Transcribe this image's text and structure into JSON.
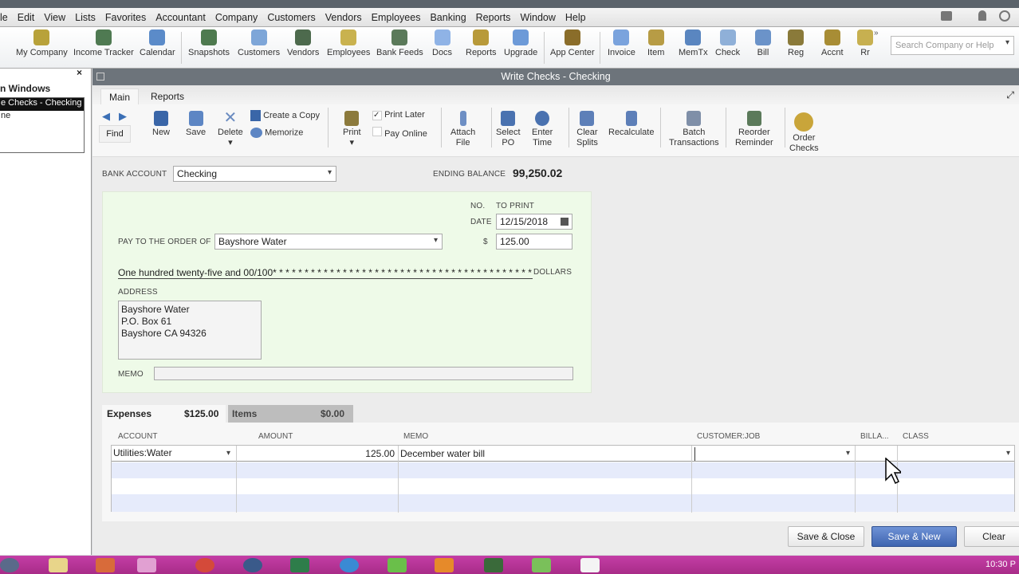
{
  "menu": [
    "le",
    "Edit",
    "View",
    "Lists",
    "Favorites",
    "Accountant",
    "Company",
    "Customers",
    "Vendors",
    "Employees",
    "Banking",
    "Reports",
    "Window",
    "Help"
  ],
  "iconbar": [
    {
      "label": "My Company",
      "icon": "my-company-icon",
      "color": "#b8a23a"
    },
    {
      "label": "Income Tracker",
      "icon": "income-tracker-icon",
      "color": "#4f7a52"
    },
    {
      "label": "Calendar",
      "icon": "calendar-icon",
      "color": "#5b8bc9"
    },
    {
      "label": "Snapshots",
      "icon": "snapshots-icon",
      "color": "#4e7a4f"
    },
    {
      "label": "Customers",
      "icon": "customers-icon",
      "color": "#7ea6d8"
    },
    {
      "label": "Vendors",
      "icon": "vendors-icon",
      "color": "#4d6a4d"
    },
    {
      "label": "Employees",
      "icon": "employees-icon",
      "color": "#c9b24f"
    },
    {
      "label": "Bank Feeds",
      "icon": "bank-feeds-icon",
      "color": "#5b7a5a"
    },
    {
      "label": "Docs",
      "icon": "docs-icon",
      "color": "#8fb3e6"
    },
    {
      "label": "Reports",
      "icon": "reports-icon",
      "color": "#b89a3a"
    },
    {
      "label": "Upgrade",
      "icon": "upgrade-icon",
      "color": "#6c9ad8"
    },
    {
      "label": "App Center",
      "icon": "app-center-icon",
      "color": "#8a6d2a"
    },
    {
      "label": "Invoice",
      "icon": "invoice-icon",
      "color": "#7aa3dd"
    },
    {
      "label": "Item",
      "icon": "item-icon",
      "color": "#b79c45"
    },
    {
      "label": "MemTx",
      "icon": "memtx-icon",
      "color": "#5a86c0"
    },
    {
      "label": "Check",
      "icon": "check-icon",
      "color": "#8fb0d8"
    },
    {
      "label": "Bill",
      "icon": "bill-icon",
      "color": "#6b93c9"
    },
    {
      "label": "Reg",
      "icon": "reg-icon",
      "color": "#8a7a3a"
    },
    {
      "label": "Accnt",
      "icon": "accnt-icon",
      "color": "#a88d35"
    },
    {
      "label": "Rr",
      "icon": "rr-icon",
      "color": "#c7b050"
    }
  ],
  "search_placeholder": "Search Company or Help",
  "open_windows": {
    "title": "n Windows",
    "items": [
      "e Checks - Checking",
      "ne"
    ]
  },
  "window": {
    "title": "Write Checks - Checking",
    "tabs": [
      "Main",
      "Reports"
    ]
  },
  "toolbar": {
    "find": "Find",
    "new": "New",
    "save": "Save",
    "delete": "Delete",
    "create_copy": "Create a Copy",
    "memorize": "Memorize",
    "print": "Print",
    "print_later": "Print Later",
    "print_later_checked": true,
    "pay_online": "Pay Online",
    "pay_online_checked": false,
    "attach": [
      "Attach",
      "File"
    ],
    "select_po": [
      "Select",
      "PO"
    ],
    "enter_time": [
      "Enter",
      "Time"
    ],
    "clear_splits": [
      "Clear",
      "Splits"
    ],
    "recalculate": "Recalculate",
    "batch": [
      "Batch",
      "Transactions"
    ],
    "reorder": [
      "Reorder",
      "Reminder"
    ],
    "order_checks": [
      "Order",
      "Checks"
    ]
  },
  "bank": {
    "label": "BANK ACCOUNT",
    "value": "Checking",
    "ending_label": "ENDING BALANCE",
    "ending_value": "99,250.02"
  },
  "check": {
    "no_label": "NO.",
    "no_value": "TO PRINT",
    "date_label": "DATE",
    "date": "12/15/2018",
    "payee_label": "PAY TO THE ORDER OF",
    "payee": "Bayshore Water",
    "dollar_sign": "$",
    "amount": "125.00",
    "amount_words": "One hundred twenty-five and 00/100* * * * * * * * * * * * * * * * * * * * * * * * * * * * * * * * * * * * * * * * *",
    "dollars": "DOLLARS",
    "address_label": "ADDRESS",
    "address": [
      "Bayshore Water",
      "P.O. Box 61",
      "Bayshore CA 94326"
    ],
    "memo_label": "MEMO",
    "memo": ""
  },
  "splits": {
    "expenses_label": "Expenses",
    "expenses_total": "$125.00",
    "items_label": "Items",
    "items_total": "$0.00"
  },
  "grid": {
    "headers": [
      "ACCOUNT",
      "AMOUNT",
      "MEMO",
      "CUSTOMER:JOB",
      "BILLA...",
      "CLASS"
    ],
    "rows": [
      {
        "account": "Utilities:Water",
        "amount": "125.00",
        "memo": "December water  bill",
        "customer": "",
        "billable": "",
        "class": ""
      }
    ]
  },
  "buttons": {
    "save_close": "Save & Close",
    "save_new": "Save & New",
    "clear": "Clear"
  },
  "clock": "10:30 P"
}
